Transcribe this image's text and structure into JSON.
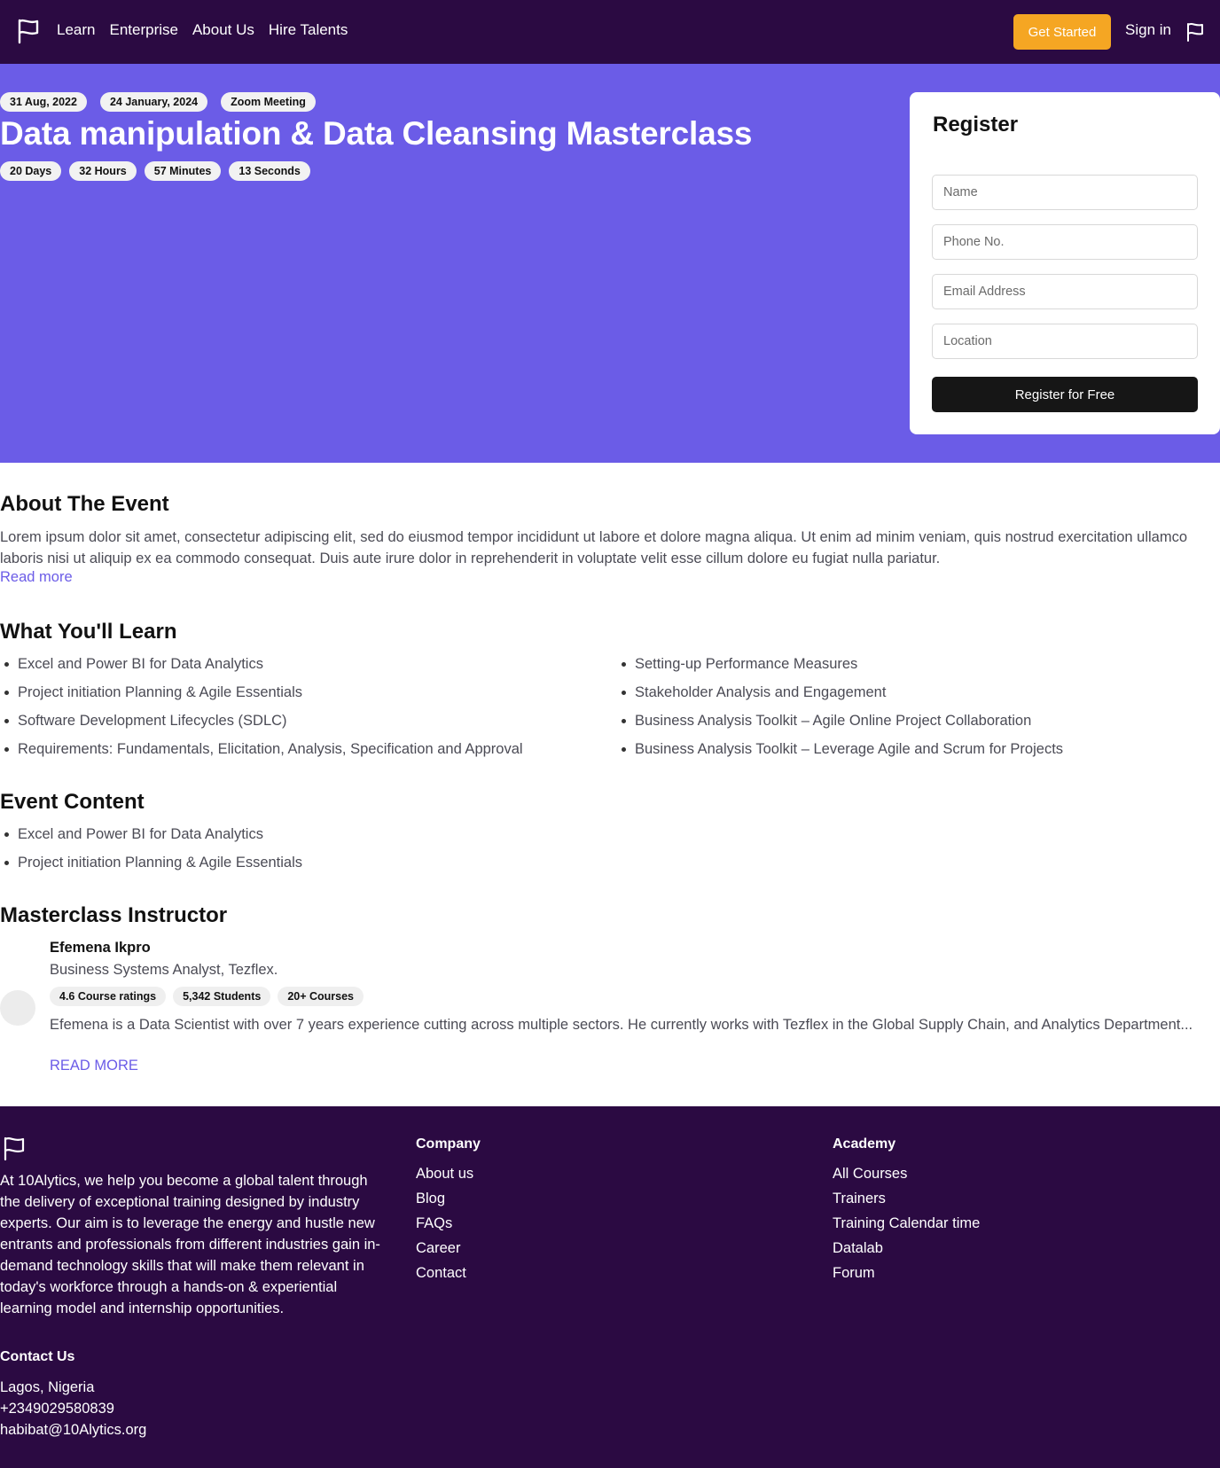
{
  "nav": {
    "links": [
      "Learn",
      "Enterprise",
      "About Us",
      "Hire Talents"
    ],
    "cta_label": "Get Started",
    "signin_label": "Sign in"
  },
  "event": {
    "dates": [
      "31 Aug, 2022",
      "24 January, 2024",
      "Zoom Meeting"
    ],
    "title": "Data manipulation & Data Cleansing Masterclass",
    "countdown": [
      "20 Days",
      "32 Hours",
      "57 Minutes",
      "13 Seconds"
    ]
  },
  "register": {
    "title": "Register",
    "fields": {
      "name": "Name",
      "phone": "Phone No.",
      "email": "Email Address",
      "location": "Location"
    },
    "button": "Register for Free"
  },
  "about": {
    "heading": "About The Event",
    "text": "Lorem ipsum dolor sit amet, consectetur adipiscing elit, sed do eiusmod tempor incididunt ut labore et dolore magna aliqua. Ut enim ad minim veniam, quis nostrud exercitation ullamco laboris nisi ut aliquip ex ea commodo consequat. Duis aute irure dolor in reprehenderit in voluptate velit esse cillum dolore eu fugiat nulla pariatur.",
    "read_more": "Read more"
  },
  "learn": {
    "heading": "What You'll Learn",
    "left": [
      "Excel and Power BI for Data Analytics",
      "Project initiation Planning & Agile Essentials",
      "Software Development Lifecycles (SDLC)",
      "Requirements: Fundamentals, Elicitation, Analysis, Specification and Approval"
    ],
    "right": [
      "Setting-up Performance Measures",
      "Stakeholder Analysis and Engagement",
      "Business Analysis Toolkit – Agile Online Project Collaboration",
      "Business Analysis Toolkit – Leverage Agile and Scrum for Projects"
    ]
  },
  "content": {
    "heading": "Event Content",
    "items": [
      "Excel and Power BI for Data Analytics",
      "Project initiation Planning & Agile Essentials"
    ]
  },
  "instructor": {
    "heading": "Masterclass Instructor",
    "name": "Efemena Ikpro",
    "role": "Business Systems Analyst, Tezflex.",
    "stats": [
      "4.6 Course ratings",
      "5,342 Students",
      "20+ Courses"
    ],
    "bio": "Efemena is a Data Scientist with over 7 years experience cutting across multiple sectors. He currently works with Tezflex in the Global Supply Chain, and Analytics Department...",
    "read_more": "READ MORE"
  },
  "footer": {
    "about": "At 10Alytics, we help you become a global talent through the delivery of exceptional training designed by industry experts. Our aim is to leverage the energy and hustle new entrants and professionals from different industries gain in-demand technology skills that will make them relevant in today's workforce through a hands-on & experiential learning model and internship opportunities.",
    "company_heading": "Company",
    "company_links": [
      "About us",
      "Blog",
      "FAQs",
      "Career",
      "Contact"
    ],
    "academy_heading": "Academy",
    "academy_links": [
      "All Courses",
      "Trainers",
      "Training Calendar time",
      "Datalab",
      "Forum"
    ],
    "contact_heading": "Contact Us",
    "contact_lines": [
      "Lagos, Nigeria",
      "+2349029580839",
      "habibat@10Alytics.org"
    ]
  },
  "colors": {
    "nav_bg": "#2b0a42",
    "hero_bg": "#6b5ce7",
    "cta": "#f5a623",
    "link": "#6b5ce7"
  }
}
